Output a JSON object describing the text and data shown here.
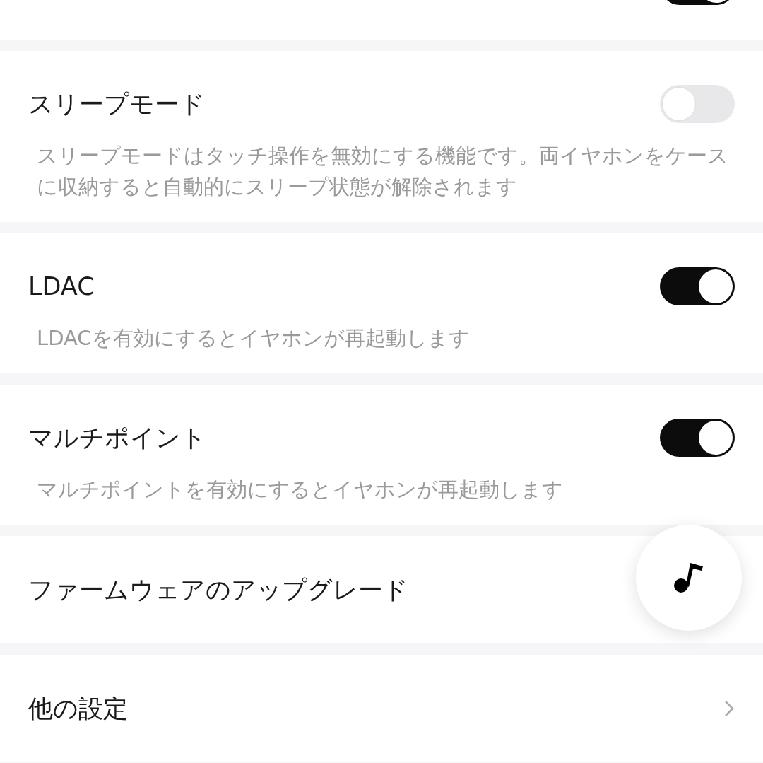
{
  "settings": [
    {
      "kind": "toggle",
      "on": true
    },
    {
      "kind": "toggle",
      "title": "スリープモード",
      "on": false,
      "description": "スリープモードはタッチ操作を無効にする機能です。両イヤホンをケースに収納すると自動的にスリープ状態が解除されます"
    },
    {
      "kind": "toggle",
      "title": "LDAC",
      "on": true,
      "description": "LDACを有効にするとイヤホンが再起動します"
    },
    {
      "kind": "toggle",
      "title": "マルチポイント",
      "on": true,
      "description": "マルチポイントを有効にするとイヤホンが再起動します"
    },
    {
      "kind": "item",
      "title": "ファームウェアのアップグレード"
    },
    {
      "kind": "link",
      "title": "他の設定"
    }
  ]
}
